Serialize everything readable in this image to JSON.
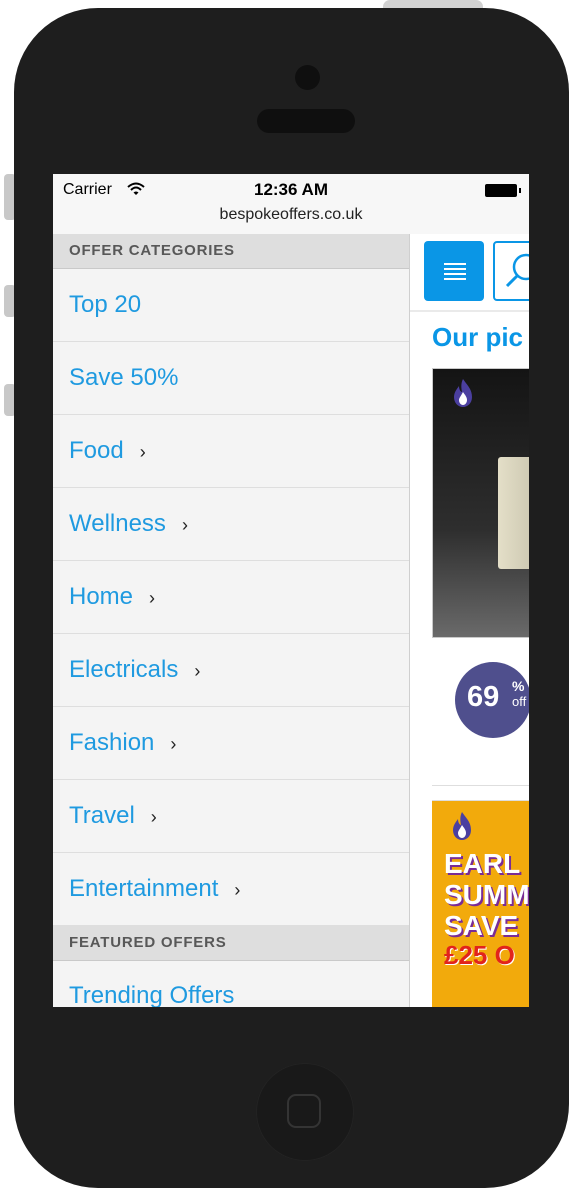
{
  "status_bar": {
    "carrier": "Carrier",
    "time": "12:36 AM",
    "url": "bespokeoffers.co.uk"
  },
  "sidebar": {
    "offer_categories_header": "OFFER CATEGORIES",
    "categories": [
      {
        "label": "Top 20",
        "has_submenu": false
      },
      {
        "label": "Save 50%",
        "has_submenu": false
      },
      {
        "label": "Food",
        "has_submenu": true
      },
      {
        "label": "Wellness",
        "has_submenu": true
      },
      {
        "label": "Home",
        "has_submenu": true
      },
      {
        "label": "Electricals",
        "has_submenu": true
      },
      {
        "label": "Fashion",
        "has_submenu": true
      },
      {
        "label": "Travel",
        "has_submenu": true
      },
      {
        "label": "Entertainment",
        "has_submenu": true
      }
    ],
    "chevron": "›",
    "featured_offers_header": "FEATURED OFFERS",
    "featured": [
      {
        "label": "Trending Offers"
      }
    ]
  },
  "content": {
    "menu_icon": "hamburger-menu-icon",
    "search_icon": "search-icon",
    "section_title": "Our pic",
    "offer1": {
      "discount_value": "69",
      "discount_percent": "%",
      "discount_off": "off"
    },
    "offer2": {
      "promo_lines": [
        "EARL",
        "SUMM",
        "SAVE"
      ],
      "promo_price": "£25 O"
    }
  },
  "colors": {
    "accent": "#0a96e6",
    "link": "#1f9ae0",
    "badge": "#4f4f8d",
    "promo_bg": "#f2aa0c"
  }
}
